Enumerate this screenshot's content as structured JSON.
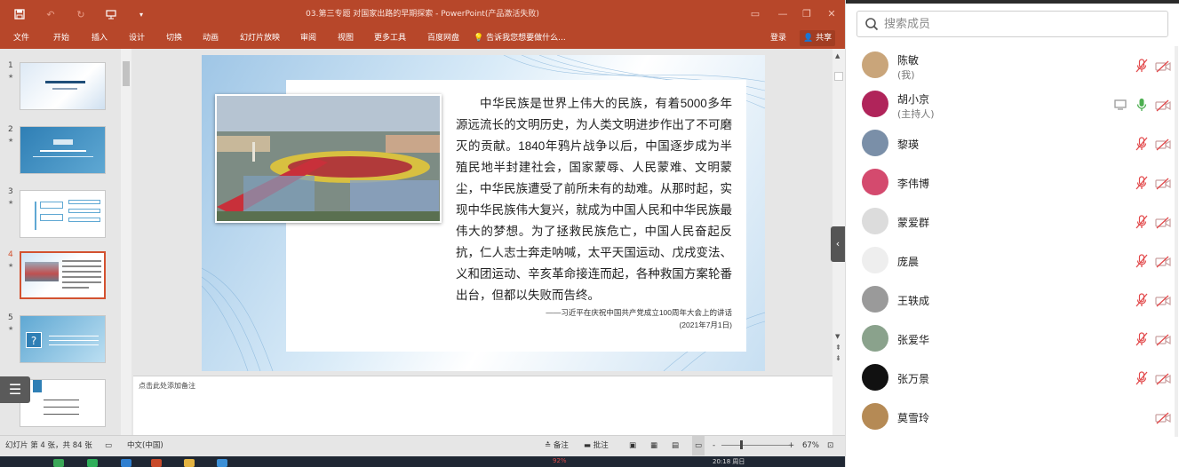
{
  "window": {
    "title": "03.第三专题  对国家出路的早期探索 - PowerPoint(产品激活失败)",
    "controls": [
      "min",
      "restore",
      "close"
    ]
  },
  "ribbon": {
    "tabs": [
      "文件",
      "开始",
      "插入",
      "设计",
      "切换",
      "动画",
      "幻灯片放映",
      "审阅",
      "视图",
      "更多工具",
      "百度网盘"
    ],
    "tell_me": "告诉我您想要做什么...",
    "login": "登录",
    "share": "共享"
  },
  "thumbnails": {
    "items": [
      {
        "num": "1"
      },
      {
        "num": "2"
      },
      {
        "num": "3"
      },
      {
        "num": "4"
      },
      {
        "num": "5"
      },
      {
        "num": "6"
      }
    ],
    "selected_index": 4
  },
  "slide": {
    "body": "中华民族是世界上伟大的民族，有着5000多年源远流长的文明历史，为人类文明进步作出了不可磨灭的贡献。1840年鸦片战争以后，中国逐步成为半殖民地半封建社会，国家蒙辱、人民蒙难、文明蒙尘，中华民族遭受了前所未有的劫难。从那时起，实现中华民族伟大复兴，就成为中国人民和中华民族最伟大的梦想。为了拯救民族危亡，中国人民奋起反抗，仁人志士奔走呐喊，太平天国运动、戊戌变法、义和团运动、辛亥革命接连而起，各种救国方案轮番出台，但都以失败而告终。",
    "citation_line1": "——习近平在庆祝中国共产党成立100周年大会上的讲话",
    "citation_line2": "(2021年7月1日)"
  },
  "notes": {
    "placeholder": "点击此处添加备注"
  },
  "statusbar": {
    "slide_info": "幻灯片 第 4 张，共 84 张",
    "language": "中文(中国)",
    "notes_label": "备注",
    "comments_label": "批注",
    "zoom": "67%"
  },
  "taskbar": {
    "battery": "92%",
    "time": "20:18 周日"
  },
  "members": {
    "search_placeholder": "搜索成员",
    "list": [
      {
        "name": "陈敏",
        "role": "(我)",
        "avatar_color": "#c9a57a",
        "mic": "muted",
        "cam": "off",
        "screen": false
      },
      {
        "name": "胡小京",
        "role": "(主持人)",
        "avatar_color": "#b0245a",
        "mic": "active",
        "cam": "off",
        "screen": true
      },
      {
        "name": "黎瑛",
        "role": "",
        "avatar_color": "#7a8fa8",
        "mic": "muted",
        "cam": "off",
        "screen": false
      },
      {
        "name": "李伟博",
        "role": "",
        "avatar_color": "#d44a6e",
        "mic": "muted",
        "cam": "off",
        "screen": false
      },
      {
        "name": "蒙爱群",
        "role": "",
        "avatar_color": "#dcdcdc",
        "mic": "muted",
        "cam": "off",
        "screen": false
      },
      {
        "name": "庞晨",
        "role": "",
        "avatar_color": "#eeeeee",
        "mic": "muted",
        "cam": "off",
        "screen": false
      },
      {
        "name": "王轶成",
        "role": "",
        "avatar_color": "#9a9a9a",
        "mic": "muted",
        "cam": "off",
        "screen": false
      },
      {
        "name": "张爱华",
        "role": "",
        "avatar_color": "#8aa28c",
        "mic": "muted",
        "cam": "off",
        "screen": false
      },
      {
        "name": "张万景",
        "role": "",
        "avatar_color": "#111111",
        "mic": "muted",
        "cam": "off",
        "screen": false
      },
      {
        "name": "莫雪玲",
        "role": "",
        "avatar_color": "#b58a55",
        "mic": "none",
        "cam": "off",
        "screen": false
      }
    ]
  },
  "colors": {
    "ppt_accent": "#b7472a",
    "muted_red": "#e2484a",
    "mic_active": "#4caf50"
  }
}
